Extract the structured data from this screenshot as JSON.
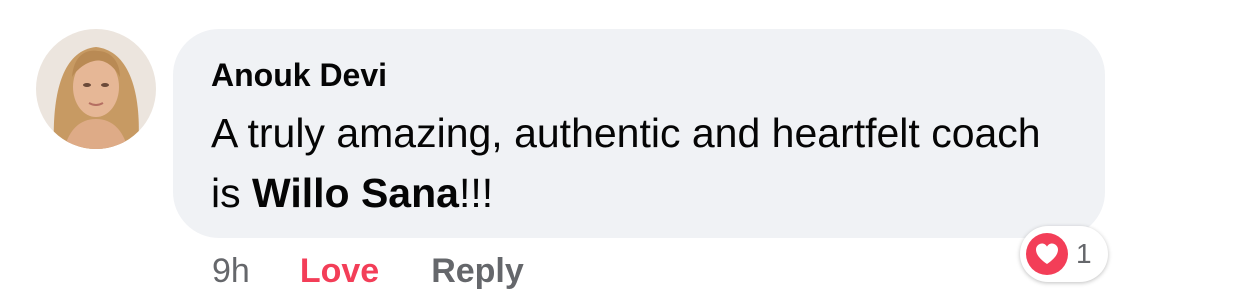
{
  "comment": {
    "author": "Anouk Devi",
    "text_before": "A truly amazing, authentic and heartfelt coach is ",
    "mention": "Willo Sana",
    "text_after": "!!!",
    "timestamp": "9h",
    "love_label": "Love",
    "reply_label": "Reply"
  },
  "reactions": {
    "type": "love",
    "count": "1",
    "love_color": "#f33e58"
  },
  "colors": {
    "bubble": "#f0f2f5",
    "text": "#050505",
    "secondary": "#65676b"
  }
}
